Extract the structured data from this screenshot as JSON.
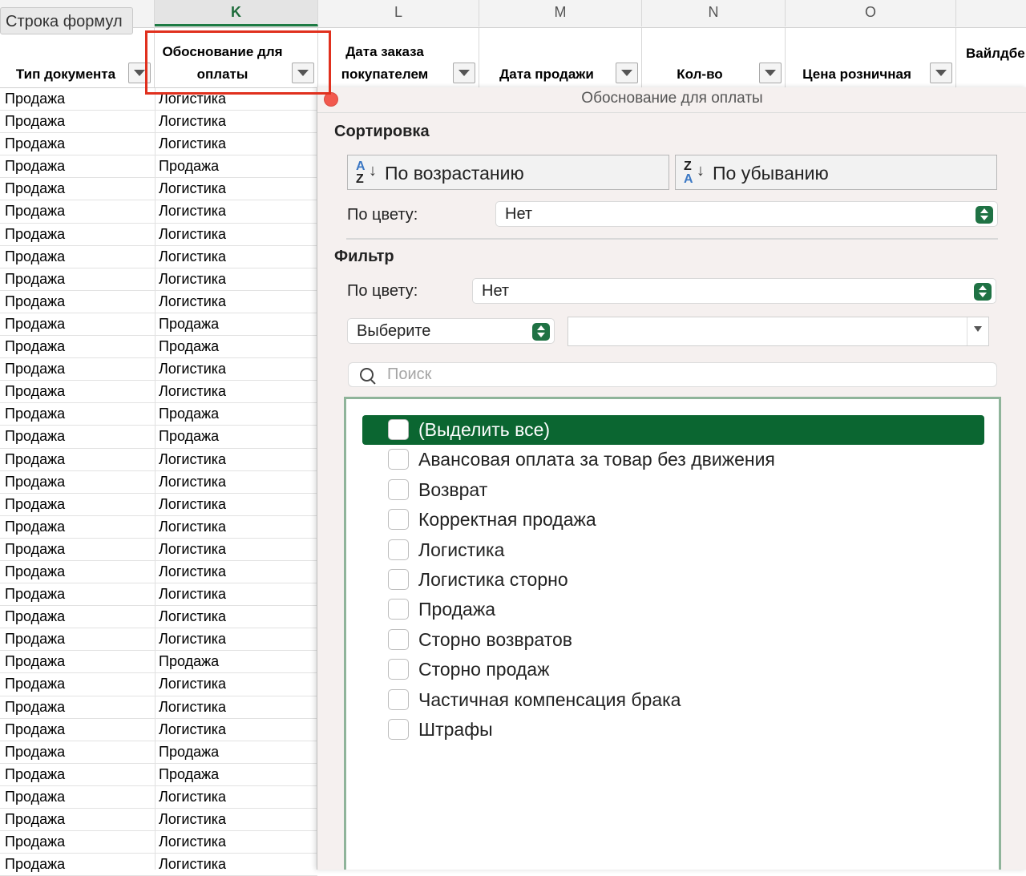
{
  "tooltip": "Строка формул",
  "columns": [
    "K",
    "L",
    "M",
    "N",
    "O"
  ],
  "headers": {
    "doc_type": "Тип документа",
    "basis_line1": "Обоснование для",
    "basis_line2": "оплаты",
    "order_date_line1": "Дата заказа",
    "order_date_line2": "покупателем",
    "sale_date": "Дата продажи",
    "qty": "Кол-во",
    "retail_price": "Цена розничная",
    "next_partial": "Вайлдбе"
  },
  "rows": [
    [
      "Продажа",
      "Логистика"
    ],
    [
      "Продажа",
      "Логистика"
    ],
    [
      "Продажа",
      "Логистика"
    ],
    [
      "Продажа",
      "Продажа"
    ],
    [
      "Продажа",
      "Логистика"
    ],
    [
      "Продажа",
      "Логистика"
    ],
    [
      "Продажа",
      "Логистика"
    ],
    [
      "Продажа",
      "Логистика"
    ],
    [
      "Продажа",
      "Логистика"
    ],
    [
      "Продажа",
      "Логистика"
    ],
    [
      "Продажа",
      "Продажа"
    ],
    [
      "Продажа",
      "Продажа"
    ],
    [
      "Продажа",
      "Логистика"
    ],
    [
      "Продажа",
      "Логистика"
    ],
    [
      "Продажа",
      "Продажа"
    ],
    [
      "Продажа",
      "Продажа"
    ],
    [
      "Продажа",
      "Логистика"
    ],
    [
      "Продажа",
      "Логистика"
    ],
    [
      "Продажа",
      "Логистика"
    ],
    [
      "Продажа",
      "Логистика"
    ],
    [
      "Продажа",
      "Логистика"
    ],
    [
      "Продажа",
      "Логистика"
    ],
    [
      "Продажа",
      "Логистика"
    ],
    [
      "Продажа",
      "Логистика"
    ],
    [
      "Продажа",
      "Логистика"
    ],
    [
      "Продажа",
      "Продажа"
    ],
    [
      "Продажа",
      "Логистика"
    ],
    [
      "Продажа",
      "Логистика"
    ],
    [
      "Продажа",
      "Логистика"
    ],
    [
      "Продажа",
      "Продажа"
    ],
    [
      "Продажа",
      "Продажа"
    ],
    [
      "Продажа",
      "Логистика"
    ],
    [
      "Продажа",
      "Логистика"
    ],
    [
      "Продажа",
      "Логистика"
    ],
    [
      "Продажа",
      "Логистика"
    ]
  ],
  "filter_popup": {
    "title": "Обоснование для оплаты",
    "sort_heading": "Сортировка",
    "sort_asc": "По возрастанию",
    "sort_desc": "По убыванию",
    "icon_a": "A",
    "icon_z": "Z",
    "icon_arrow": "↓",
    "sort_by_color_label": "По цвету:",
    "sort_by_color_value": "Нет",
    "filter_heading": "Фильтр",
    "filter_by_color_label": "По цвету:",
    "filter_by_color_value": "Нет",
    "choose_value": "Выберите",
    "search_placeholder": "Поиск",
    "items": [
      "(Выделить все)",
      "Авансовая оплата за товар без движения",
      "Возврат",
      "Корректная продажа",
      "Логистика",
      "Логистика сторно",
      "Продажа",
      "Сторно возвратов",
      "Сторно продаж",
      "Частичная компенсация брака",
      "Штрафы"
    ]
  },
  "colors": {
    "accent_green": "#0b6631",
    "highlight_red": "#e0301e"
  }
}
